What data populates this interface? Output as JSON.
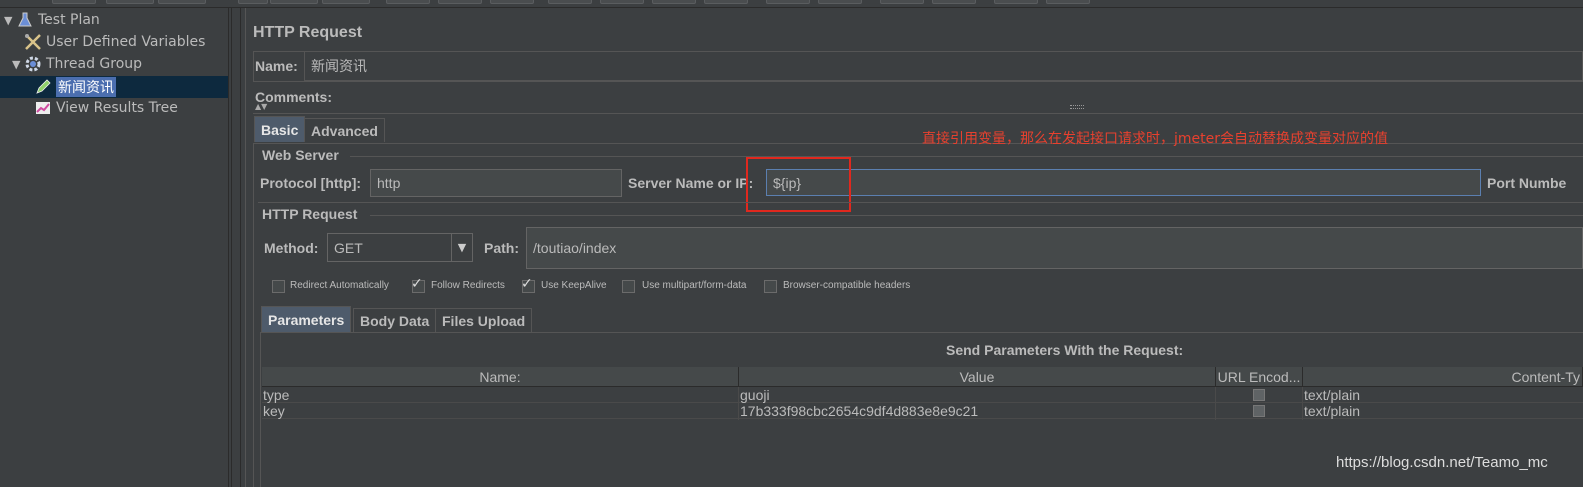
{
  "tree": {
    "items": [
      {
        "label": "Test Plan",
        "icon": "flask-icon"
      },
      {
        "label": "User Defined Variables",
        "icon": "wrench-icon"
      },
      {
        "label": "Thread Group",
        "icon": "gear-icon"
      },
      {
        "label": "新闻资讯",
        "icon": "pencil-icon"
      },
      {
        "label": "View Results Tree",
        "icon": "chart-icon"
      }
    ]
  },
  "sampler": {
    "title": "HTTP Request",
    "name_label": "Name:",
    "name_value": "新闻资讯",
    "comments_label": "Comments:",
    "tabs": [
      "Basic",
      "Advanced"
    ],
    "web_server": {
      "section_title": "Web Server",
      "protocol_label": "Protocol [http]:",
      "protocol_value": "http",
      "server_label": "Server Name or IP:",
      "server_value": "${ip}",
      "port_label": "Port Numbe"
    },
    "http_request": {
      "section_title": "HTTP Request",
      "method_label": "Method:",
      "method_value": "GET",
      "path_label": "Path:",
      "path_value": "/toutiao/index"
    },
    "options": [
      {
        "label": "Redirect Automatically",
        "checked": false
      },
      {
        "label": "Follow Redirects",
        "checked": true
      },
      {
        "label": "Use KeepAlive",
        "checked": true
      },
      {
        "label": "Use multipart/form-data",
        "checked": false
      },
      {
        "label": "Browser-compatible headers",
        "checked": false
      }
    ],
    "body_tabs": [
      "Parameters",
      "Body Data",
      "Files Upload"
    ],
    "params_title": "Send Parameters With the Request:",
    "columns": [
      "Name:",
      "Value",
      "URL Encod...",
      "Content-Ty"
    ],
    "rows": [
      {
        "name": "type",
        "value": "guoji",
        "content_type": "text/plain"
      },
      {
        "name": "key",
        "value": "17b333f98cbc2654c9df4d883e8e9c21",
        "content_type": "text/plain"
      }
    ]
  },
  "annotation": "直接引用变量，那么在发起接口请求时，jmeter会自动替换成变量对应的值",
  "watermark": "https://blog.csdn.net/Teamo_mc",
  "colors": {
    "accent": "#4b6eaf",
    "annotation": "#e8402e",
    "background": "#3c3f41"
  }
}
